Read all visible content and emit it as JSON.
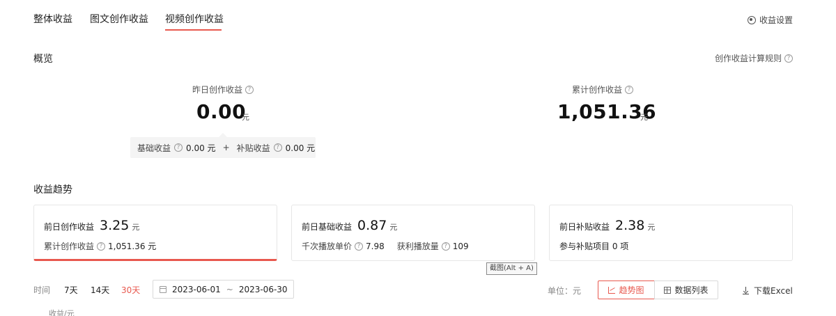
{
  "tabs": [
    {
      "label": "整体收益"
    },
    {
      "label": "图文创作收益"
    },
    {
      "label": "视频创作收益"
    }
  ],
  "settings_label": "收益设置",
  "overview": {
    "title": "概览",
    "rules_link": "创作收益计算规则",
    "yesterday": {
      "label": "昨日创作收益",
      "value": "0.00",
      "unit": "元"
    },
    "total": {
      "label": "累计创作收益",
      "value": "1,051.36",
      "unit": "元"
    },
    "breakdown": {
      "base_label": "基础收益",
      "base_value": "0.00 元",
      "plus": "+",
      "subsidy_label": "补贴收益",
      "subsidy_value": "0.00 元"
    }
  },
  "trend": {
    "title": "收益趋势",
    "cards": [
      {
        "label": "前日创作收益",
        "value": "3.25",
        "unit": "元",
        "sub_label": "累计创作收益",
        "sub_value": "1,051.36 元"
      },
      {
        "label": "前日基础收益",
        "value": "0.87",
        "unit": "元",
        "sub_label1": "千次播放单价",
        "sub_value1": "7.98",
        "sub_label2": "获利播放量",
        "sub_value2": "109"
      },
      {
        "label": "前日补贴收益",
        "value": "2.38",
        "unit": "元",
        "sub_text": "参与补贴项目 0 项"
      }
    ]
  },
  "tooltip": "截图(Alt + A)",
  "filters": {
    "time_label": "时间",
    "ranges": [
      "7天",
      "14天",
      "30天"
    ],
    "active_range_index": 2,
    "date_start": "2023-06-01",
    "date_sep": "~",
    "date_end": "2023-06-30",
    "unit_label": "单位：元",
    "trend_button": "趋势图",
    "list_button": "数据列表",
    "download": "下载Excel"
  },
  "chart": {
    "y_label": "收益/元"
  },
  "colors": {
    "accent": "#e8584e"
  }
}
